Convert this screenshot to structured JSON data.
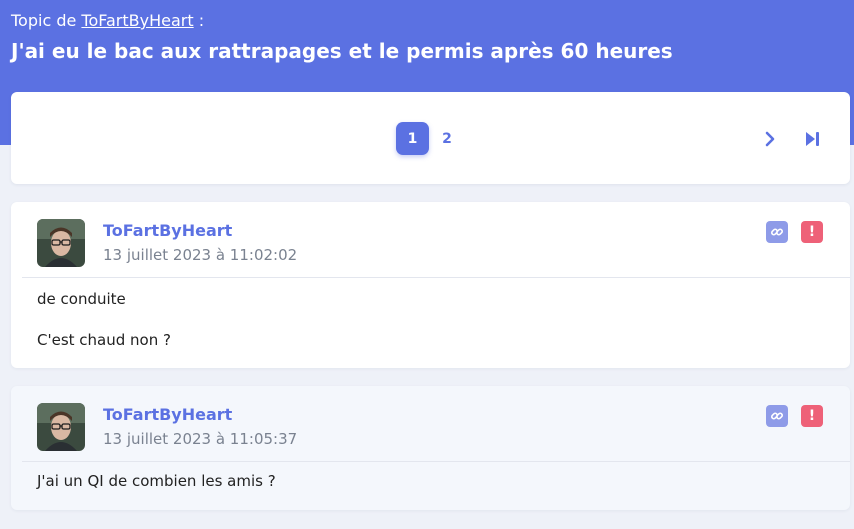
{
  "header": {
    "topic_prefix": "Topic de",
    "topic_author": "ToFartByHeart",
    "topic_suffix": " :",
    "title": "J'ai eu le bac aux rattrapages et le permis après 60 heures"
  },
  "pagination": {
    "current_page": "1",
    "other_page": "2",
    "next_icon": "chevron-right",
    "last_icon": "skip-to-last"
  },
  "posts": [
    {
      "author": "ToFartByHeart",
      "date": "13 juillet 2023 à 11:02:02",
      "lines": [
        "de conduite",
        "C'est chaud non ?"
      ],
      "actions": {
        "link_icon": "link-icon",
        "report_label": "!"
      }
    },
    {
      "author": "ToFartByHeart",
      "date": "13 juillet 2023 à 11:05:37",
      "lines": [
        "J'ai un QI de combien les amis ?"
      ],
      "actions": {
        "link_icon": "link-icon",
        "report_label": "!"
      }
    }
  ],
  "colors": {
    "accent": "#5b71e2",
    "link_button": "#8e9be8",
    "report_button": "#ee6178",
    "page_background": "#eef1f8"
  }
}
